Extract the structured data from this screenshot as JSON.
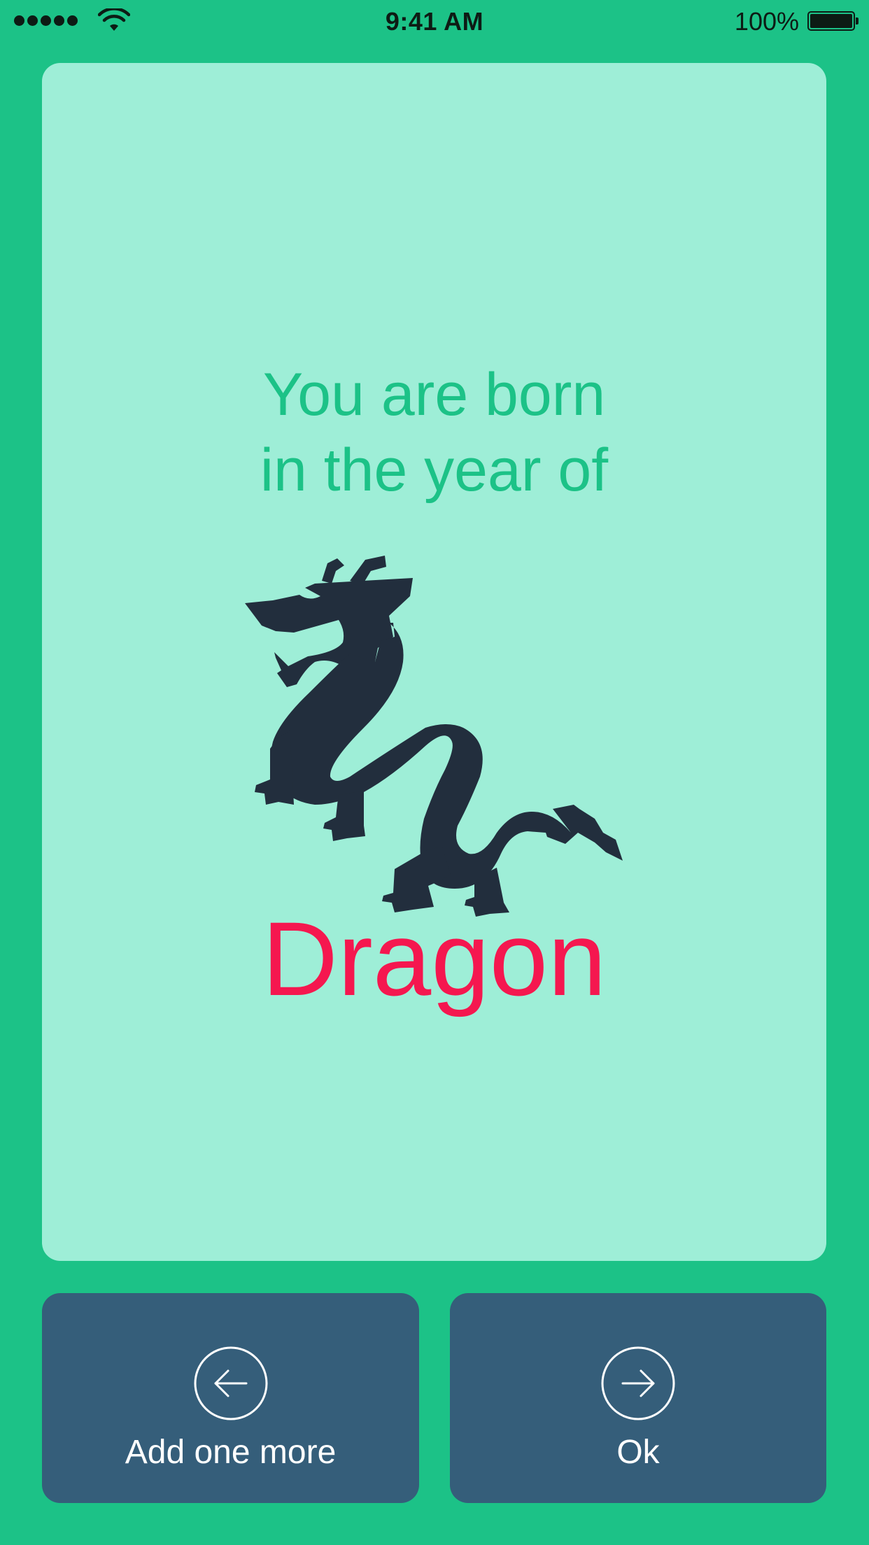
{
  "status_bar": {
    "time": "9:41 AM",
    "battery_percent": "100%",
    "signal_bars": 5
  },
  "card": {
    "line1": "You are born",
    "line2": "in the year of",
    "zodiac_icon": "dragon-icon",
    "zodiac_name": "Dragon"
  },
  "buttons": {
    "left": {
      "label": "Add one more",
      "icon": "arrow-left-circle-icon"
    },
    "right": {
      "label": "Ok",
      "icon": "arrow-right-circle-icon"
    }
  },
  "colors": {
    "background": "#1cc287",
    "card": "#9eeed7",
    "accent_text": "#1cc287",
    "zodiac_name": "#f5174f",
    "button": "#355e7a",
    "dragon": "#222e3d"
  }
}
